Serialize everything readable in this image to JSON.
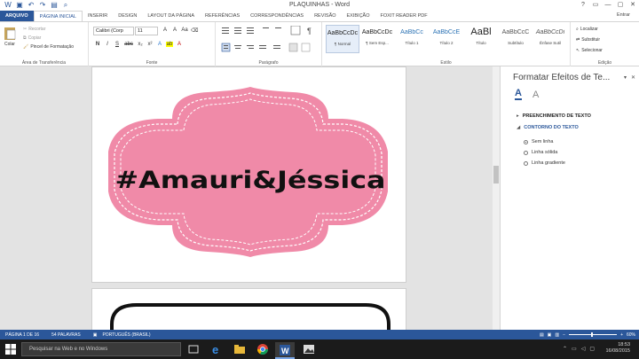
{
  "window": {
    "title": "PLAQUINHAS - Word",
    "controls": [
      "?",
      "▭",
      "—",
      "▢",
      "✕"
    ]
  },
  "tabs": [
    {
      "label": "ARQUIVO"
    },
    {
      "label": "PÁGINA INICIAL"
    },
    {
      "label": "INSERIR"
    },
    {
      "label": "DESIGN"
    },
    {
      "label": "LAYOUT DA PÁGINA"
    },
    {
      "label": "REFERÊNCIAS"
    },
    {
      "label": "CORRESPONDÊNCIAS"
    },
    {
      "label": "REVISÃO"
    },
    {
      "label": "EXIBIÇÃO"
    },
    {
      "label": "FOXIT READER PDF"
    }
  ],
  "signin": "Entrar",
  "clipboard": {
    "paste": "Colar",
    "cut": "Recortar",
    "copy": "Copiar",
    "painter": "Pincel de Formatação",
    "label": "Área de Transferência"
  },
  "font": {
    "name": "Calibri (Corp",
    "size": "11",
    "label": "Fonte",
    "row2": [
      "N",
      "I",
      "S",
      "abc",
      "x₂",
      "x²"
    ]
  },
  "paragraph": {
    "label": "Parágrafo"
  },
  "styles": {
    "label": "Estilo",
    "items": [
      {
        "sample": "AaBbCcDc",
        "name": "¶ Normal"
      },
      {
        "sample": "AaBbCcDc",
        "name": "¶ Sem Esp..."
      },
      {
        "sample": "AaBbCc",
        "name": "Título 1"
      },
      {
        "sample": "AaBbCcE",
        "name": "Título 2"
      },
      {
        "sample": "AaBl",
        "name": "Título"
      },
      {
        "sample": "AaBbCcC",
        "name": "Subtítulo"
      },
      {
        "sample": "AaBbCcDi",
        "name": "Ênfase Sutil"
      }
    ]
  },
  "editing": {
    "label": "Edição",
    "find": "Localizar",
    "replace": "Substituir",
    "select": "Selecionar"
  },
  "document": {
    "label_text": "#Amauri&Jéssica",
    "colors": {
      "pink": "#f08aa8",
      "border": "#ffffff",
      "text": "#111111"
    }
  },
  "pane": {
    "title": "Formatar Efeitos de Te...",
    "fill_section": "PREENCHIMENTO DE TEXTO",
    "outline_section": "CONTORNO DO TEXTO",
    "options": [
      {
        "label": "Sem linha",
        "selected": true
      },
      {
        "label": "Linha sólida",
        "selected": false
      },
      {
        "label": "Linha gradiente",
        "selected": false
      }
    ]
  },
  "status": {
    "page": "PÁGINA 1 DE 16",
    "words": "54 PALAVRAS",
    "language": "PORTUGUÊS (BRASIL)",
    "zoom": "60%"
  },
  "taskbar": {
    "search_placeholder": "Pesquisar na Web e no Windows",
    "time": "18:53",
    "date": "16/08/2015"
  }
}
